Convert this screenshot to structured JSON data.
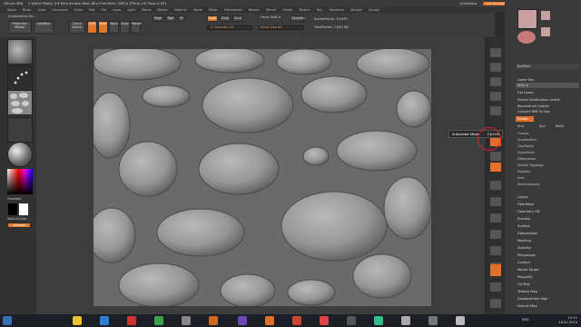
{
  "titlebar": {
    "app": "ZBrush 4R6",
    "info": "1  Active Points: 5.6 Mil  ▸ Scratch Disk: 66  ▸ Free Mem: 3387  ▸ ZTime 1.6  Timer 0.031",
    "quicksave": "QuickSave",
    "seethrough": "See-through  0",
    "menus": "Menus",
    "script": "DefaultZScript"
  },
  "menubar": [
    "Alpha",
    "Brush",
    "Color",
    "Document",
    "Draw",
    "Edit",
    "File",
    "Layer",
    "Light",
    "Macro",
    "Marker",
    "Material",
    "Movie",
    "Picker",
    "Preferences",
    "Render",
    "Stencil",
    "Stroke",
    "Texture",
    "Tool",
    "Transform",
    "Zplugin",
    "Zscript"
  ],
  "shelf": {
    "doc_name": "Subdividing AA...",
    "projection_master": "Projection Master",
    "lightbox": "LightBox",
    "quick_sketch": "Quick Sketch",
    "edit": "Edit",
    "draw": "Draw",
    "move": "Move",
    "scale": "Scale",
    "rotate": "Rotate",
    "mrgb": "Mrgb",
    "rgb": "Rgb",
    "m": "M",
    "zadd": "Zadd",
    "zsub": "Zsub",
    "zcut": "Zcut",
    "z_intensity": "Z Intensity 25",
    "focal_shift": "Focal Shift 0",
    "draw_size": "Draw Size 64",
    "dynamic": "Dynamic",
    "active_points": "ActivePoints: 19,635",
    "total_points": "TotalPoints: 7.840 Mil"
  },
  "left_tray": {
    "gradient": "Gradient",
    "switch_color": "SwitchColor",
    "alternate": "Alternate"
  },
  "tooltip": {
    "label": "Subdivide Mesh",
    "shortcut": "Ctrl+D"
  },
  "palette": {
    "subtool_title": "SubTool",
    "items": [
      "Lower Res",
      "SDiv 6",
      "Del Lower",
      "Freeze SubDivision Levels",
      "Reconstruct Subdiv",
      "Convert BPR To Geo",
      "Divide",
      "Smt",
      "Suv",
      "ReUV",
      "Crease",
      "ShadowBox",
      "ClayPolish",
      "DynaMesh",
      "ZRemesher",
      "Modify Topology",
      "Position",
      "Size",
      "MeshIntegrity",
      "Layers",
      "FiberMesh",
      "Geometry HD",
      "Preview",
      "Surface",
      "Deformation",
      "Masking",
      "Visibility",
      "Polygroups",
      "Contact",
      "Morph Target",
      "Polypaint",
      "UV Map",
      "Texture Map",
      "Displacement Map",
      "Normal Map"
    ],
    "subdivide_button": "Divide",
    "colors": {
      "accent": "#e0702a",
      "panel": "#3a3a3a",
      "text": "#dcdcdc"
    }
  },
  "taskbar": {
    "lang": "ENG",
    "time": "10:21",
    "date": "18.02.2015"
  }
}
